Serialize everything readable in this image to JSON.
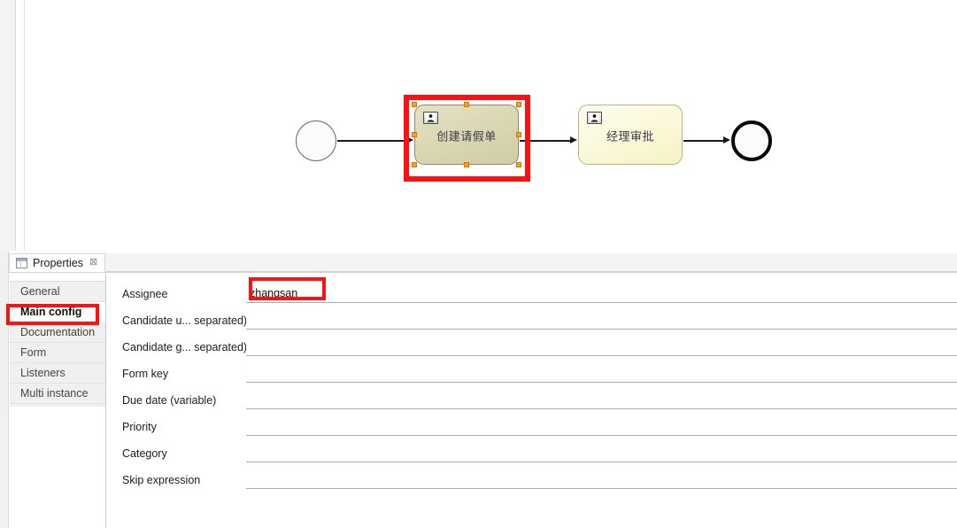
{
  "canvas": {
    "diagram": {
      "start_event": {
        "name": "start-event"
      },
      "end_event": {
        "name": "end-event"
      },
      "tasks": [
        {
          "label": "创建请假单",
          "icon": "user-task-icon",
          "selected": true
        },
        {
          "label": "经理审批",
          "icon": "user-task-icon",
          "selected": false
        }
      ]
    }
  },
  "properties_view": {
    "tab_title": "Properties",
    "tab_close_glyph": "⊠",
    "tab_icon": "properties-view-icon"
  },
  "tab_list": {
    "items": [
      {
        "label": "General",
        "selected": false
      },
      {
        "label": "Main config",
        "selected": true
      },
      {
        "label": "Documentation",
        "selected": false
      },
      {
        "label": "Form",
        "selected": false
      },
      {
        "label": "Listeners",
        "selected": false
      },
      {
        "label": "Multi instance",
        "selected": false
      }
    ]
  },
  "form": {
    "fields": [
      {
        "label": "Assignee",
        "value": "zhangsan",
        "placeholder": ""
      },
      {
        "label": "Candidate u... separated)",
        "value": "",
        "placeholder": ""
      },
      {
        "label": "Candidate g... separated)",
        "value": "",
        "placeholder": ""
      },
      {
        "label": "Form key",
        "value": "",
        "placeholder": ""
      },
      {
        "label": "Due date (variable)",
        "value": "",
        "placeholder": ""
      },
      {
        "label": "Priority",
        "value": "",
        "placeholder": ""
      },
      {
        "label": "Category",
        "value": "",
        "placeholder": ""
      },
      {
        "label": "Skip expression",
        "value": "",
        "placeholder": ""
      }
    ]
  },
  "annotations": {
    "highlight_color": "#ff1111",
    "boxes": [
      {
        "name": "annotation-selected-task"
      },
      {
        "name": "annotation-assignee-value"
      },
      {
        "name": "annotation-main-config-tab"
      }
    ]
  }
}
